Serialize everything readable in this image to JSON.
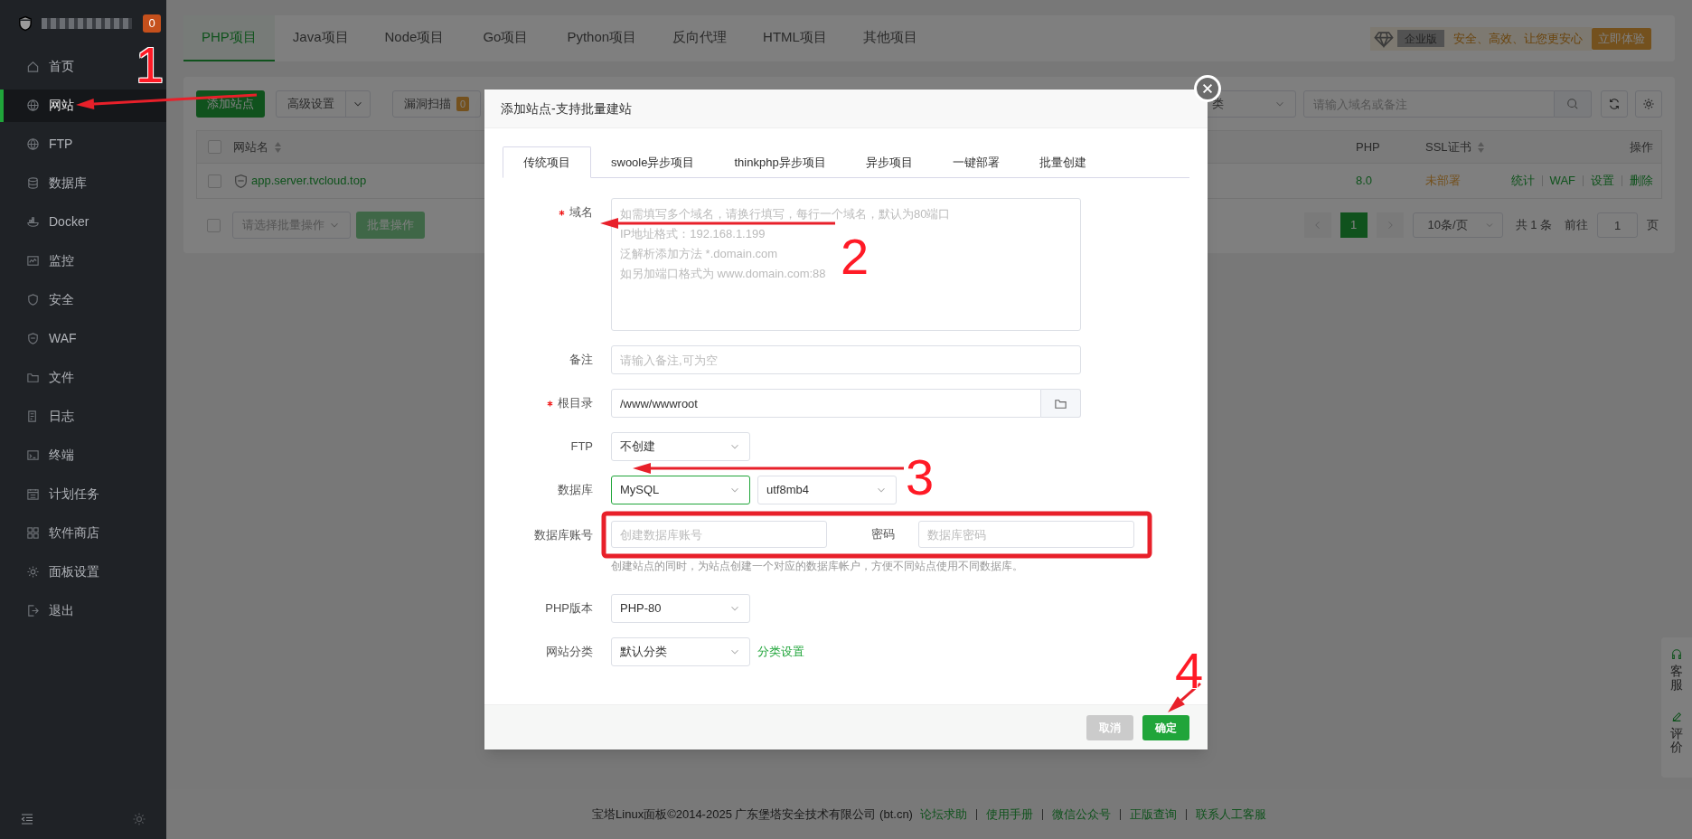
{
  "sidebar": {
    "badge": "0",
    "items": [
      {
        "label": "首页",
        "selected": false
      },
      {
        "label": "网站",
        "selected": true
      },
      {
        "label": "FTP",
        "selected": false
      },
      {
        "label": "数据库",
        "selected": false
      },
      {
        "label": "Docker",
        "selected": false
      },
      {
        "label": "监控",
        "selected": false
      },
      {
        "label": "安全",
        "selected": false
      },
      {
        "label": "WAF",
        "selected": false
      },
      {
        "label": "文件",
        "selected": false
      },
      {
        "label": "日志",
        "selected": false
      },
      {
        "label": "终端",
        "selected": false
      },
      {
        "label": "计划任务",
        "selected": false
      },
      {
        "label": "软件商店",
        "selected": false
      },
      {
        "label": "面板设置",
        "selected": false
      },
      {
        "label": "退出",
        "selected": false
      }
    ]
  },
  "top_tabs": [
    {
      "label": "PHP项目",
      "selected": true
    },
    {
      "label": "Java项目",
      "selected": false
    },
    {
      "label": "Node项目",
      "selected": false
    },
    {
      "label": "Go项目",
      "selected": false
    },
    {
      "label": "Python项目",
      "selected": false
    },
    {
      "label": "反向代理",
      "selected": false
    },
    {
      "label": "HTML项目",
      "selected": false
    },
    {
      "label": "其他项目",
      "selected": false
    }
  ],
  "promo": {
    "edition": "企业版",
    "slogan": "安全、高效、让您更安心",
    "button": "立即体验"
  },
  "toolbar": {
    "add_button": "添加站点",
    "advanced_button": "高级设置",
    "scan_button": "漏洞扫描",
    "scan_count": "0",
    "category_select": "类",
    "search_placeholder": "请输入域名或备注"
  },
  "table": {
    "all_checked": false,
    "columns": [
      {
        "label": "网站名",
        "sortable": true
      },
      {
        "label": "PHP",
        "sortable": false
      },
      {
        "label": "SSL证书",
        "sortable": true
      },
      {
        "label": "操作",
        "sortable": false
      }
    ],
    "rows": [
      {
        "checked": false,
        "name": "app.server.tvcloud.top",
        "php": "8.0",
        "ssl": "未部署",
        "actions": [
          "统计",
          "WAF",
          "设置",
          "删除"
        ]
      }
    ]
  },
  "batch": {
    "checked": false,
    "placeholder": "请选择批量操作",
    "button": "批量操作"
  },
  "pagination": {
    "pages": [
      {
        "label": "1",
        "selected": true
      }
    ],
    "page_size": "10条/页",
    "total": "共 1 条",
    "goto_label": "前往",
    "goto_value": "1",
    "page_unit": "页"
  },
  "footer": {
    "copyright": "宝塔Linux面板©2014-2025 广东堡塔安全技术有限公司 (bt.cn)",
    "links": [
      "论坛求助",
      "使用手册",
      "微信公众号",
      "正版查询",
      "联系人工客服"
    ]
  },
  "side_float": [
    "客服",
    "评价"
  ],
  "dialog": {
    "title": "添加站点-支持批量建站",
    "tabs": [
      {
        "label": "传统项目",
        "selected": true
      },
      {
        "label": "swoole异步项目",
        "selected": false
      },
      {
        "label": "thinkphp异步项目",
        "selected": false
      },
      {
        "label": "异步项目",
        "selected": false
      },
      {
        "label": "一键部署",
        "selected": false
      },
      {
        "label": "批量创建",
        "selected": false
      }
    ],
    "fields": [
      {
        "kind": "textarea",
        "label": "域名",
        "required": true,
        "placeholder": "如需填写多个域名，请换行填写，每行一个域名，默认为80端口\nIP地址格式：192.168.1.199\n泛解析添加方法 *.domain.com\n如另加端口格式为 www.domain.com:88"
      },
      {
        "kind": "input",
        "label": "备注",
        "required": false,
        "placeholder": "请输入备注,可为空"
      },
      {
        "kind": "path",
        "label": "根目录",
        "required": true,
        "value": "/www/wwwroot"
      },
      {
        "kind": "select",
        "label": "FTP",
        "required": false,
        "selects": [
          {
            "value": "不创建",
            "focused": false
          }
        ]
      },
      {
        "kind": "select",
        "label": "数据库",
        "required": false,
        "selects": [
          {
            "value": "MySQL",
            "focused": true
          },
          {
            "value": "utf8mb4",
            "focused": false
          }
        ]
      },
      {
        "kind": "account",
        "label": "数据库账号",
        "required": false,
        "placeholder": "创建数据库账号",
        "password_label": "密码",
        "password_placeholder": "数据库密码",
        "hint": "创建站点的同时，为站点创建一个对应的数据库帐户，方便不同站点使用不同数据库。"
      },
      {
        "kind": "select",
        "label": "PHP版本",
        "required": false,
        "selects": [
          {
            "value": "PHP-80",
            "focused": false
          }
        ]
      },
      {
        "kind": "select",
        "label": "网站分类",
        "required": false,
        "selects": [
          {
            "value": "默认分类",
            "focused": false
          }
        ],
        "link": "分类设置"
      }
    ],
    "buttons": [
      {
        "label": "取消",
        "kind": "cancel"
      },
      {
        "label": "确定",
        "kind": "primary"
      }
    ]
  },
  "annotations": [
    {
      "kind": "arrow",
      "label": "1"
    },
    {
      "kind": "arrow",
      "label": "2"
    },
    {
      "kind": "arrow",
      "label": "3"
    },
    {
      "kind": "frame"
    },
    {
      "kind": "arrow",
      "label": "4"
    }
  ]
}
